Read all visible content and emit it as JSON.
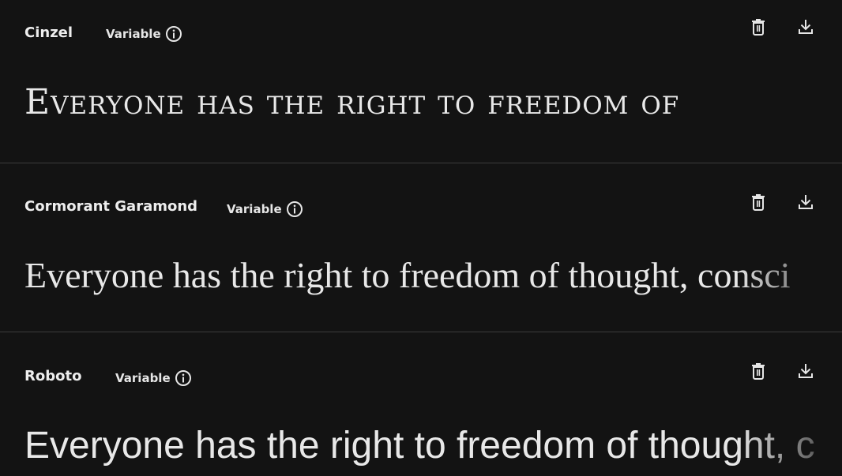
{
  "fonts": [
    {
      "name": "Cinzel",
      "tag": "Variable",
      "sample": "Everyone has the right to freedom of"
    },
    {
      "name": "Cormorant Garamond",
      "tag": "Variable",
      "sample": "Everyone has the right to freedom of thought, consci"
    },
    {
      "name": "Roboto",
      "tag": "Variable",
      "sample": "Everyone has the right to freedom of thought, c"
    }
  ],
  "icons": {
    "info": "info-icon",
    "delete": "trash-icon",
    "download": "download-icon"
  },
  "colors": {
    "background": "#131313",
    "divider": "#3c3c3c",
    "text": "#e6e6e6"
  }
}
